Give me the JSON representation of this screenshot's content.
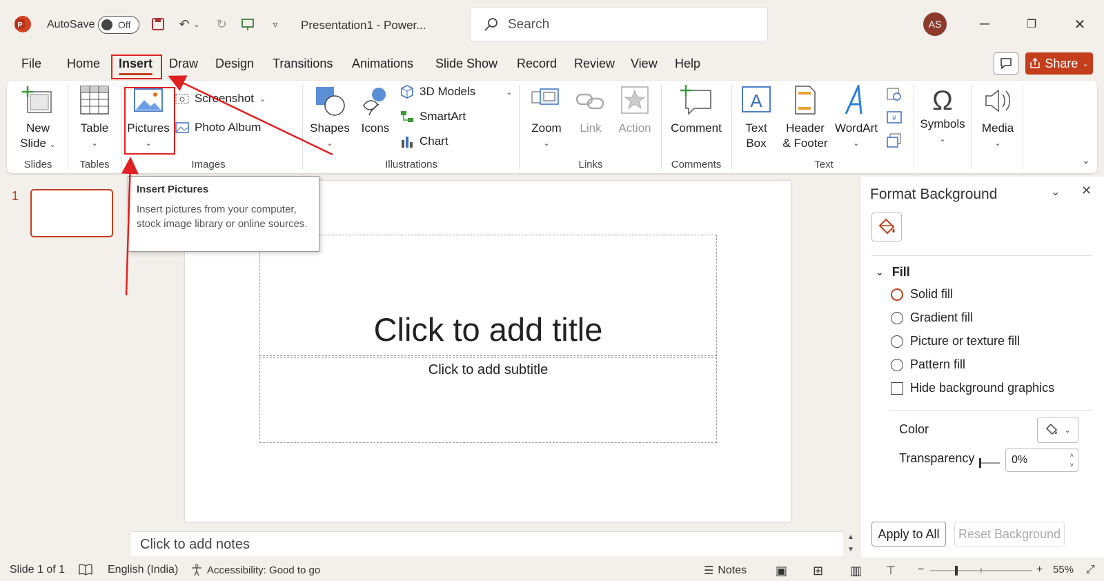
{
  "titlebar": {
    "autosave_label": "AutoSave",
    "autosave_state": "Off",
    "document_title": "Presentation1  -  Power...",
    "search_placeholder": "Search",
    "avatar_initials": "AS"
  },
  "tabs": [
    "File",
    "Home",
    "Insert",
    "Draw",
    "Design",
    "Transitions",
    "Animations",
    "Slide Show",
    "Record",
    "Review",
    "View",
    "Help"
  ],
  "active_tab": "Insert",
  "share_label": "Share",
  "ribbon": {
    "slides": {
      "new_slide": "New",
      "new_slide_2": "Slide",
      "group": "Slides"
    },
    "tables": {
      "table": "Table",
      "group": "Tables"
    },
    "images": {
      "pictures": "Pictures",
      "screenshot": "Screenshot",
      "photo_album": "Photo Album",
      "group": "Images"
    },
    "illustrations": {
      "shapes": "Shapes",
      "icons": "Icons",
      "models": "3D Models",
      "smartart": "SmartArt",
      "chart": "Chart",
      "group": "Illustrations"
    },
    "links": {
      "zoom": "Zoom",
      "link": "Link",
      "action": "Action",
      "group": "Links"
    },
    "comments": {
      "comment": "Comment",
      "group": "Comments"
    },
    "text": {
      "textbox_1": "Text",
      "textbox_2": "Box",
      "header_1": "Header",
      "header_2": "& Footer",
      "wordart": "WordArt",
      "group": "Text"
    },
    "symbols": {
      "label": "Symbols"
    },
    "media": {
      "label": "Media"
    }
  },
  "tooltip": {
    "title": "Insert Pictures",
    "body": "Insert pictures from your computer, stock image library or online sources."
  },
  "thumbnails": {
    "slide_number": "1"
  },
  "slide": {
    "title_placeholder": "Click to add title",
    "subtitle_placeholder": "Click to add subtitle"
  },
  "notes_placeholder": "Click to add notes",
  "format_pane": {
    "title": "Format Background",
    "fill_header": "Fill",
    "options": [
      "Solid fill",
      "Gradient fill",
      "Picture or texture fill",
      "Pattern fill"
    ],
    "hide_graphics": "Hide background graphics",
    "color_label": "Color",
    "transparency_label": "Transparency",
    "transparency_value": "0%",
    "apply_all": "Apply to All",
    "reset": "Reset Background"
  },
  "statusbar": {
    "slide_info": "Slide 1 of 1",
    "language": "English (India)",
    "accessibility": "Accessibility: Good to go",
    "notes": "Notes",
    "zoom": "55%"
  },
  "colors": {
    "accent": "#c43e1c",
    "annotation": "#e02020"
  }
}
